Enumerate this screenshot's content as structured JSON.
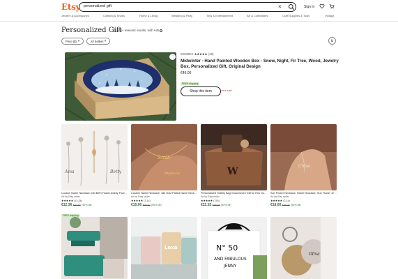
{
  "header": {
    "logo": "Etsy",
    "search_value": "personalized gift",
    "signin_label": "Sign in",
    "nav_items": [
      "Jewelry & Accessories",
      "Clothing & Shoes",
      "Home & Living",
      "Wedding & Party",
      "Toys & Entertainment",
      "Art & Collectibles",
      "Craft Supplies & Tools",
      "Vintage"
    ]
  },
  "page": {
    "title": "Personalized Gift",
    "results": "(1,000+ relevant results, with Ads"
  },
  "filters": {
    "price_label": "Price ($)",
    "category_label": "All Sellers",
    "sort_icon": "sort-icon"
  },
  "featured": {
    "shop": "ESSDEX",
    "stars": "★★★★★",
    "count": "(19)",
    "title": "Midwinter - Hand Painted Wooden Box - Snow, Night, Fir Tree, Wood, Jewelry Box, Personalized Gift, Original Design",
    "price": "€49.00",
    "shipping": "FREE shipping",
    "stock": "Only 1 available and it's in 1 person's cart",
    "button_label": "Shop this item"
  },
  "products": [
    {
      "title": "Custom Name Necklace with Birth Flower,Dainty Flower Necklace",
      "seller": "Ad by Etsy seller",
      "stars": "★★★★★",
      "count": "(14,5k)",
      "price": "€12.36",
      "orig": "€20.60",
      "off": "(40% off)",
      "badge": "FREE shipping"
    },
    {
      "title": "Custom Name Necklace, 18k Gold Plated Name Necklace",
      "seller": "Ad by Etsy seller",
      "stars": "★★★★★",
      "count": "(3,1k)",
      "price": "€15.00",
      "orig": "€30.00",
      "off": "(50% off)",
      "badge": ""
    },
    {
      "title": "Personalized Toiletry Bag Groomsmen Gift for Him Dopp Kit",
      "seller": "Ad by Etsy seller",
      "stars": "★★★★★",
      "count": "(785)",
      "price": "€22.52",
      "orig": "€45.04",
      "off": "(50% off)",
      "badge": ""
    },
    {
      "title": "Sun Flower Necklace, Name Necklace, Sun Flower Jewelry",
      "seller": "Ad by Etsy seller",
      "stars": "★★★★★",
      "count": "(2,1k)",
      "price": "€18.00",
      "orig": "€36.00",
      "off": "(50% off)",
      "badge": ""
    }
  ],
  "row2": [
    {
      "text": ""
    },
    {
      "text": "Lexa"
    },
    {
      "text": "N° 50 AND FABULOUS JENNY"
    },
    {
      "text": "Oliva"
    }
  ]
}
